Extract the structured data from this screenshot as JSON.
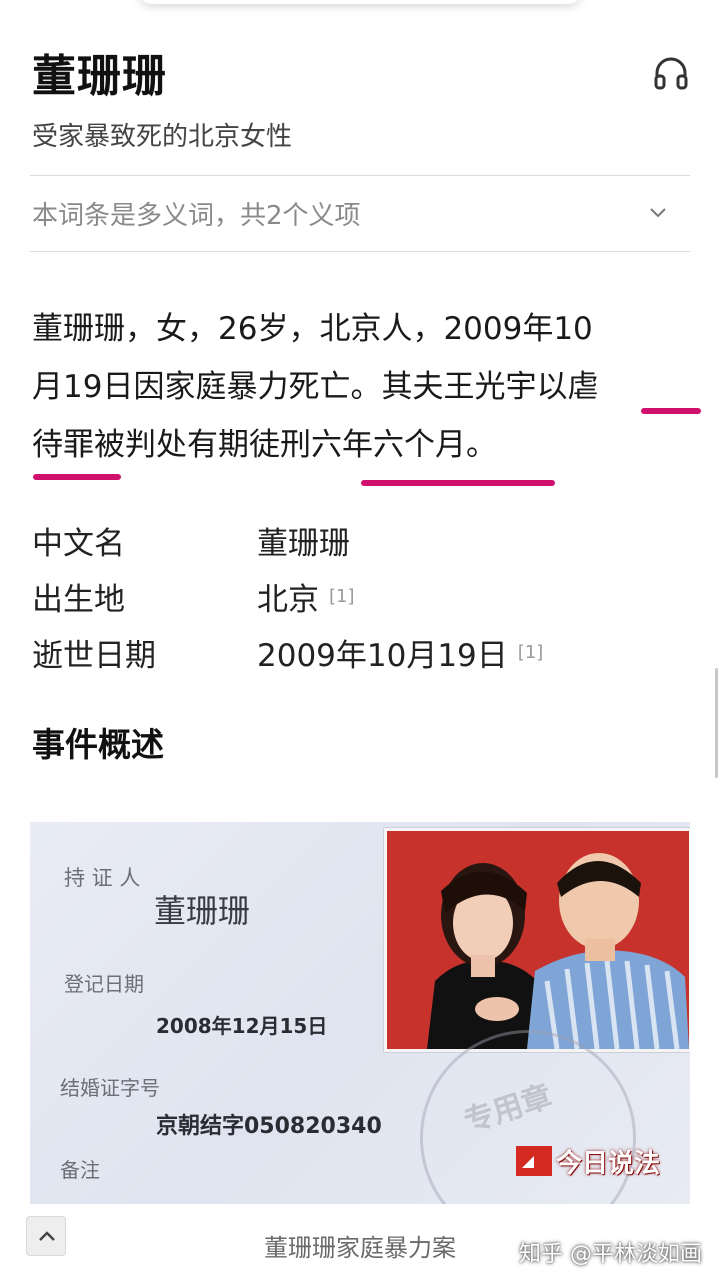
{
  "entry": {
    "title": "董珊珊",
    "subtitle": "受家暴致死的北京女性",
    "polysemy_notice": "本词条是多义词，共2个义项"
  },
  "summary": {
    "line1": "董珊珊，女，26岁，北京人，2009年10",
    "line2": "月19日因家庭暴力死亡。其夫王光宇以虐",
    "line3": "待罪被判处有期徒刑六年六个月。"
  },
  "highlight_color": "#d0106c",
  "info": [
    {
      "label": "中文名",
      "value": "董珊珊",
      "ref": ""
    },
    {
      "label": "出生地",
      "value": "北京",
      "ref": "[1]"
    },
    {
      "label": "逝世日期",
      "value": "2009年10月19日",
      "ref": "[1]"
    }
  ],
  "section": {
    "title": "事件概述"
  },
  "photo": {
    "holder_label": "持 证 人",
    "holder_name": "董珊珊",
    "date_label": "登记日期",
    "date_value": "2008年12月15日",
    "cert_no_label": "结婚证字号",
    "cert_no_value": "京朝结字050820340",
    "remark_label": "备注",
    "seal_text": "专用章",
    "tv_logo": "今日说法",
    "caption": "董珊珊家庭暴力案"
  },
  "watermark": "知乎 @平林淡如画",
  "icons": {
    "listen": "headphone-icon",
    "expand": "chevron-down-icon",
    "back_to_top": "chevron-up-icon"
  }
}
